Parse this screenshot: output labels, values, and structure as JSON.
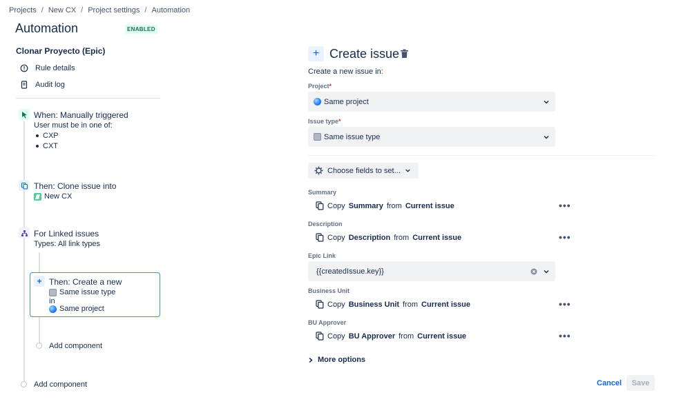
{
  "breadcrumbs": [
    "Projects",
    "New CX",
    "Project settings",
    "Automation"
  ],
  "breadcrumb_sep": "/",
  "page_title": "Automation",
  "status_lozenge": "ENABLED",
  "rule_name": "Clonar Proyecto (Epic)",
  "side_links": {
    "rule_details": "Rule details",
    "audit_log": "Audit log"
  },
  "steps": {
    "trigger": {
      "title": "When: Manually triggered",
      "sub": "User must be in one of:",
      "groups": [
        "CXP",
        "CXT"
      ]
    },
    "clone": {
      "title": "Then: Clone issue into",
      "project": "New CX"
    },
    "branch": {
      "title": "For Linked issues",
      "sub": "Types: All link types"
    },
    "create": {
      "title": "Then: Create a new",
      "issue_type": "Same issue type",
      "in": "in",
      "project": "Same project"
    },
    "add_inner": "Add component",
    "add_outer": "Add component"
  },
  "panel": {
    "title": "Create issue",
    "intro": "Create a new issue in:",
    "project_label": "Project",
    "project_value": "Same project",
    "issue_type_label": "Issue type",
    "issue_type_value": "Same issue type",
    "required_mark": "*",
    "choose_fields": "Choose fields to set...",
    "fields": {
      "summary": {
        "label": "Summary",
        "copy": "Copy",
        "field": "Summary",
        "from": "from",
        "source": "Current issue"
      },
      "description": {
        "label": "Description",
        "copy": "Copy",
        "field": "Description",
        "from": "from",
        "source": "Current issue"
      },
      "epic_link": {
        "label": "Epic Link",
        "value": "{{createdIssue.key}}"
      },
      "business_unit": {
        "label": "Business Unit",
        "copy": "Copy",
        "field": "Business Unit",
        "from": "from",
        "source": "Current issue"
      },
      "bu_approver": {
        "label": "BU Approver",
        "copy": "Copy",
        "field": "BU Approver",
        "from": "from",
        "source": "Current issue"
      }
    },
    "more_options": "More options",
    "cancel": "Cancel",
    "save": "Save"
  },
  "colors": {
    "accent": "#0c66e4",
    "selected_border": "#388bff",
    "enabled_bg": "#dcfff1",
    "enabled_fg": "#216e4e"
  }
}
